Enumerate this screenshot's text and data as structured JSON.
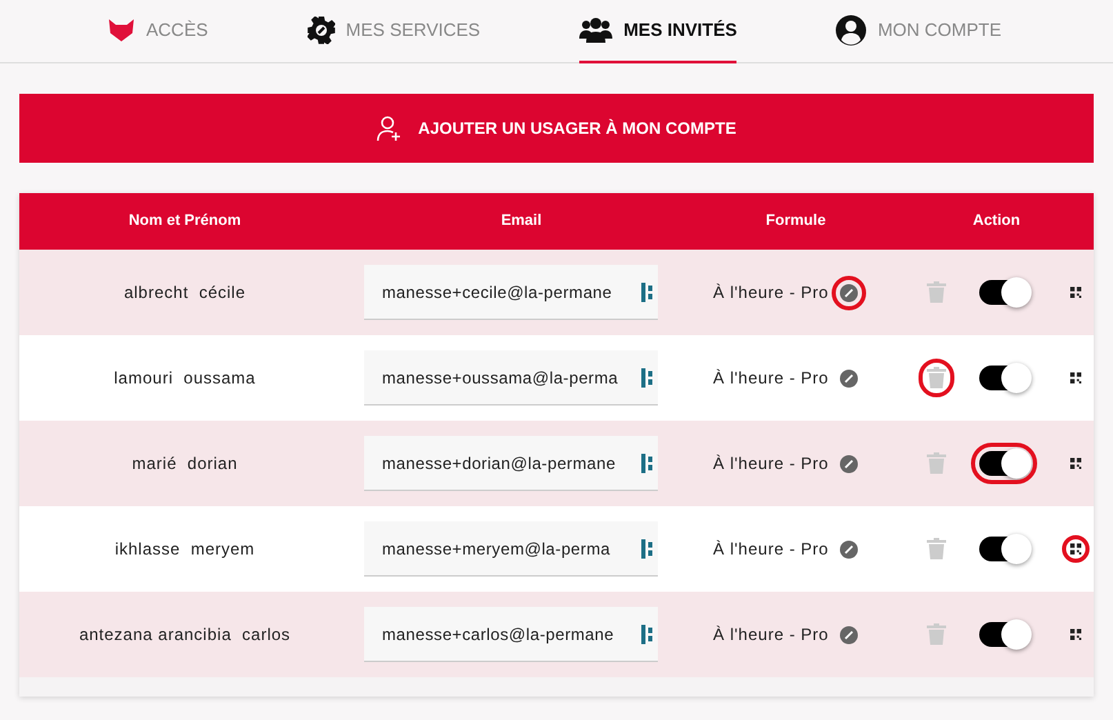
{
  "tabs": [
    {
      "label": "ACCÈS",
      "kind": "cat",
      "selected": false
    },
    {
      "label": "MES SERVICES",
      "kind": "gear",
      "selected": false
    },
    {
      "label": "MES INVITÉS",
      "kind": "users",
      "selected": true
    },
    {
      "label": "MON COMPTE",
      "kind": "user",
      "selected": false
    }
  ],
  "add_button": {
    "label": "AJOUTER UN USAGER À MON COMPTE"
  },
  "table": {
    "columns": [
      "Nom et Prénom",
      "Email",
      "Formule",
      "Action"
    ],
    "rows": [
      {
        "name": "albrecht  cécile",
        "email": "manesse+cecile@la-permane",
        "formule": "À l'heure - Pro",
        "on": true,
        "edit_circled": true,
        "delete_circled": false,
        "toggle_circled": false,
        "qr_circled": false
      },
      {
        "name": "lamouri  oussama",
        "email": "manesse+oussama@la-perma",
        "formule": "À l'heure - Pro",
        "on": true,
        "edit_circled": false,
        "delete_circled": true,
        "toggle_circled": false,
        "qr_circled": false
      },
      {
        "name": "marié  dorian",
        "email": "manesse+dorian@la-permane",
        "formule": "À l'heure - Pro",
        "on": true,
        "edit_circled": false,
        "delete_circled": false,
        "toggle_circled": true,
        "qr_circled": false
      },
      {
        "name": "ikhlasse  meryem",
        "email": "manesse+meryem@la-perma",
        "formule": "À l'heure - Pro",
        "on": true,
        "edit_circled": false,
        "delete_circled": false,
        "toggle_circled": false,
        "qr_circled": true
      },
      {
        "name": "antezana arancibia  carlos",
        "email": "manesse+carlos@la-permane",
        "formule": "À l'heure - Pro",
        "on": true,
        "edit_circled": false,
        "delete_circled": false,
        "toggle_circled": false,
        "qr_circled": false
      }
    ]
  }
}
